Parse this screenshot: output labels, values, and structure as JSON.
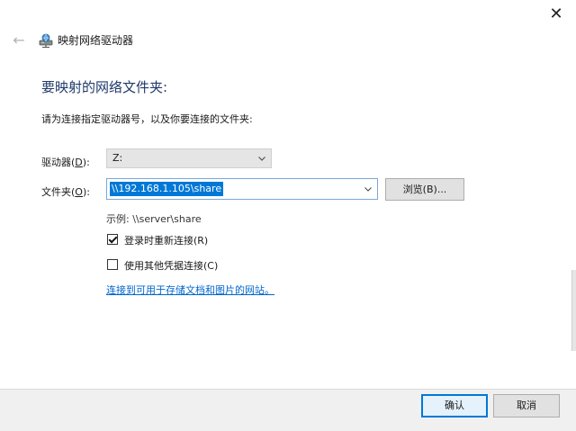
{
  "window": {
    "close_glyph": "✕",
    "back_glyph": "←",
    "title": "映射网络驱动器",
    "title_icon": "network-drive-icon"
  },
  "main": {
    "heading": "要映射的网络文件夹:",
    "instruction": "请为连接指定驱动器号，以及你要连接的文件夹:"
  },
  "drive": {
    "label_prefix": "驱动器(",
    "label_key": "D",
    "label_suffix": "):",
    "selected": "Z:"
  },
  "folder": {
    "label_prefix": "文件夹(",
    "label_key": "O",
    "label_suffix": "):",
    "value": "\\\\192.168.1.105\\share",
    "browse_label": "浏览(B)..."
  },
  "example": "示例: \\\\server\\share",
  "options": {
    "reconnect": {
      "label": "登录时重新连接(R)",
      "checked": true
    },
    "other_credentials": {
      "label": "使用其他凭据连接(C)",
      "checked": false
    }
  },
  "link": {
    "text": "连接到可用于存储文档和图片的网站。"
  },
  "footer": {
    "ok_label": "确认",
    "cancel_label": "取消"
  },
  "colors": {
    "accent": "#0078d7",
    "heading": "#1f3a6b",
    "link": "#0066cc"
  }
}
